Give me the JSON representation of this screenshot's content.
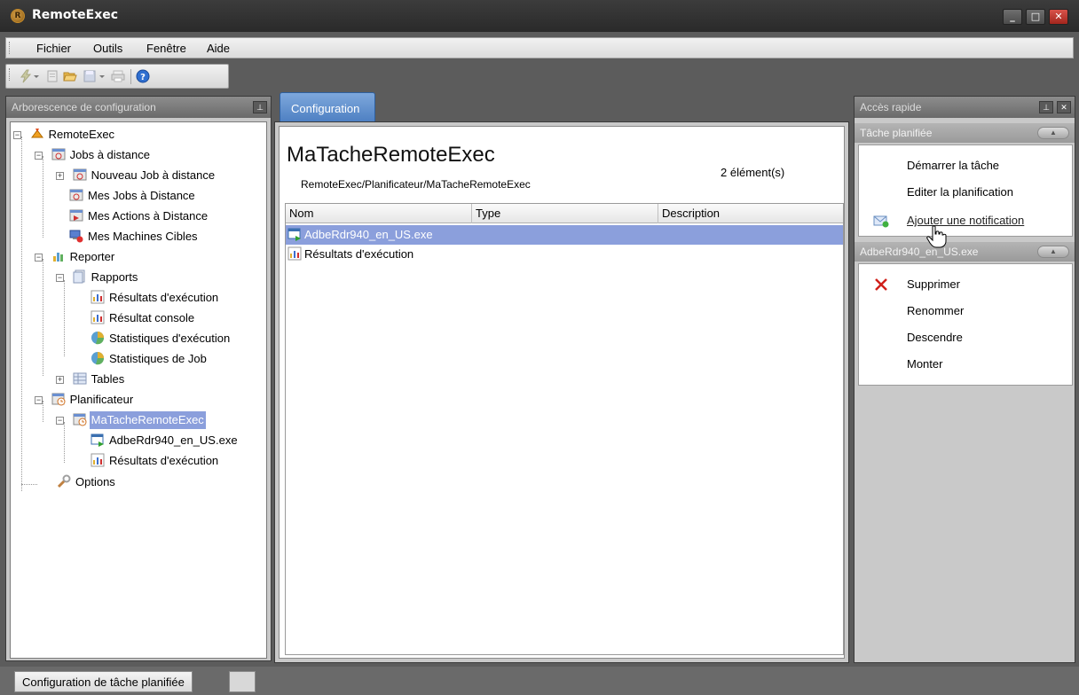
{
  "window": {
    "title": "RemoteExec",
    "app_icon_letter": "R",
    "minimize": "_",
    "maximize": "□",
    "close": "✕"
  },
  "menu": [
    "Fichier",
    "Outils",
    "Fenêtre",
    "Aide"
  ],
  "toolbar": {
    "icons": [
      "run-icon",
      "dropdown-arrow-icon",
      "new-icon",
      "open-folder-icon",
      "save-icon",
      "dropdown-arrow-icon",
      "print-icon",
      "help-icon"
    ]
  },
  "left_panel": {
    "title": "Arborescence de configuration",
    "pin": "⊥",
    "tree": [
      {
        "label": "RemoteExec"
      },
      {
        "label": "Jobs à distance"
      },
      {
        "label": "Nouveau Job à distance"
      },
      {
        "label": "Mes Jobs à Distance"
      },
      {
        "label": "Mes Actions à Distance"
      },
      {
        "label": "Mes Machines Cibles"
      },
      {
        "label": "Reporter"
      },
      {
        "label": "Rapports"
      },
      {
        "label": "Résultats d'exécution"
      },
      {
        "label": "Résultat console"
      },
      {
        "label": "Statistiques d'exécution"
      },
      {
        "label": "Statistiques de Job"
      },
      {
        "label": "Tables"
      },
      {
        "label": "Planificateur"
      },
      {
        "label": "MaTacheRemoteExec"
      },
      {
        "label": "AdbeRdr940_en_US.exe"
      },
      {
        "label": "Résultats d'exécution"
      },
      {
        "label": "Options"
      }
    ]
  },
  "center": {
    "tab": "Configuration",
    "title": "MaTacheRemoteExec",
    "path": "RemoteExec/Planificateur/MaTacheRemoteExec",
    "count": "2 élément(s)",
    "columns": [
      "Nom",
      "Type",
      "Description"
    ],
    "rows": [
      {
        "name": "AdbeRdr940_en_US.exe"
      },
      {
        "name": "Résultats d'exécution"
      }
    ]
  },
  "right_panel": {
    "title": "Accès rapide",
    "pin": "⊥",
    "close": "✕",
    "section1": {
      "title": "Tâche planifiée",
      "actions": [
        "Démarrer la tâche",
        "Editer la planification",
        "Ajouter une notification"
      ]
    },
    "section2": {
      "title": "AdbeRdr940_en_US.exe",
      "actions": [
        "Supprimer",
        "Renommer",
        "Descendre",
        "Monter"
      ]
    }
  },
  "status": {
    "text": "Configuration de tâche planifiée"
  },
  "colors": {
    "selection": "#8b9fdc",
    "tab": "#4d7fc2",
    "delete": "#d0201a"
  }
}
